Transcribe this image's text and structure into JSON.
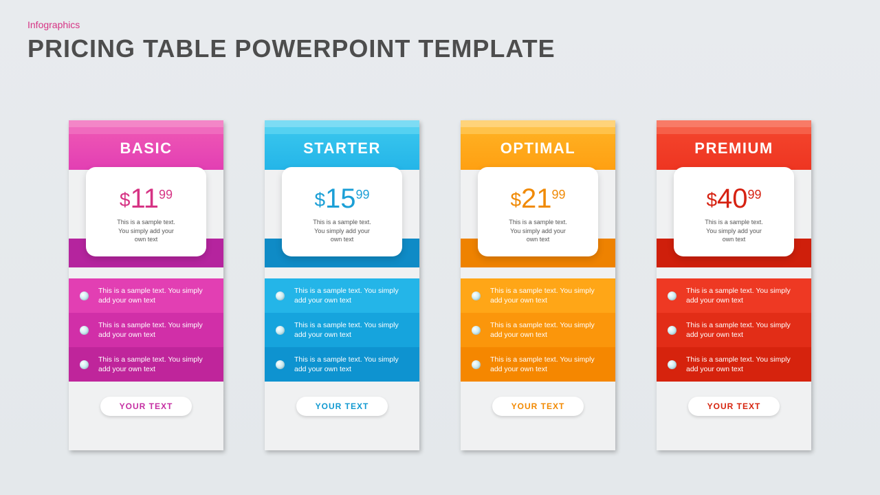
{
  "kicker": "Infographics",
  "headline": "PRICING TABLE POWERPOINT TEMPLATE",
  "price_note": "This is a sample text.\nYou simply add your\nown text",
  "feature_text": "This is a sample text. You simply add your own text",
  "cta_label": "YOUR TEXT",
  "tiers": [
    {
      "name": "BASIC",
      "currency": "$",
      "price": "11",
      "cents": "99"
    },
    {
      "name": "STARTER",
      "currency": "$",
      "price": "15",
      "cents": "99"
    },
    {
      "name": "OPTIMAL",
      "currency": "$",
      "price": "21",
      "cents": "99"
    },
    {
      "name": "PREMIUM",
      "currency": "$",
      "price": "40",
      "cents": "99"
    }
  ]
}
